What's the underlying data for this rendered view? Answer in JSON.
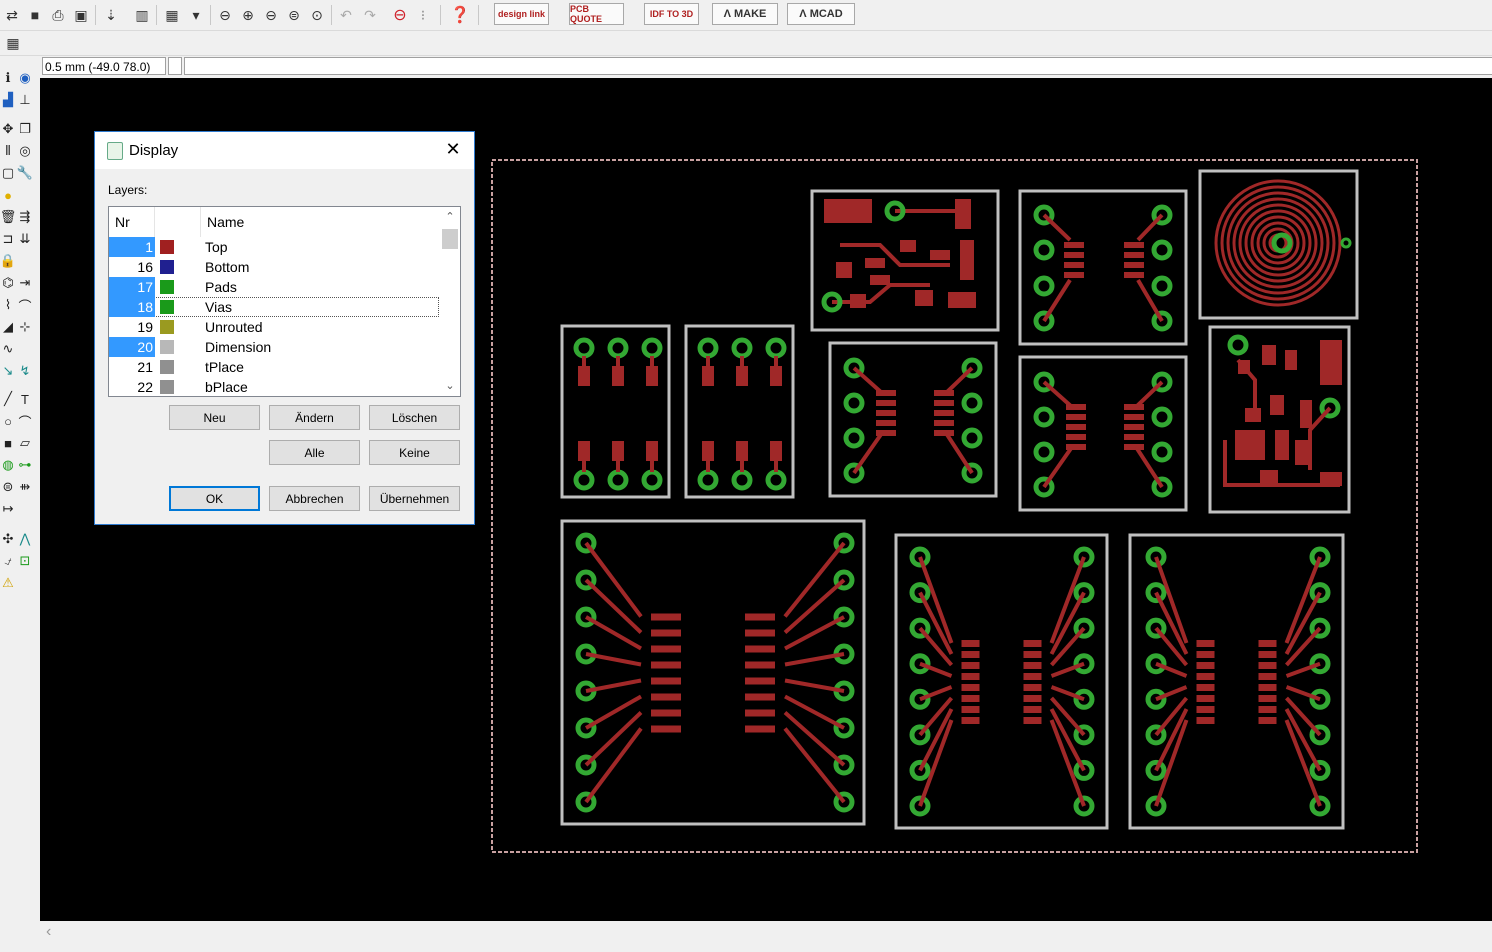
{
  "toolbar": {
    "designlink_label": "design link",
    "pcbquote_label": "PCB QUOTE",
    "idf_label": "IDF TO 3D",
    "make_label": "MAKE",
    "mcad_label": "MCAD"
  },
  "coordinate": "0.5 mm (-49.0 78.0)",
  "dialog": {
    "title": "Display",
    "layers_label": "Layers:",
    "col_nr": "Nr",
    "col_name": "Name",
    "layers": [
      {
        "nr": "1",
        "name": "Top",
        "color": "#a02020",
        "selected": true
      },
      {
        "nr": "16",
        "name": "Bottom",
        "color": "#202090",
        "selected": false
      },
      {
        "nr": "17",
        "name": "Pads",
        "color": "#1a9a1a",
        "selected": true
      },
      {
        "nr": "18",
        "name": "Vias",
        "color": "#1a9a1a",
        "selected": true
      },
      {
        "nr": "19",
        "name": "Unrouted",
        "color": "#9a9a20",
        "selected": false
      },
      {
        "nr": "20",
        "name": "Dimension",
        "color": "#b8b8b8",
        "selected": true
      },
      {
        "nr": "21",
        "name": "tPlace",
        "color": "#909090",
        "selected": false
      },
      {
        "nr": "22",
        "name": "bPlace",
        "color": "#909090",
        "selected": false
      }
    ],
    "btn_new": "Neu",
    "btn_change": "Ändern",
    "btn_delete": "Löschen",
    "btn_all": "Alle",
    "btn_none": "Keine",
    "btn_ok": "OK",
    "btn_cancel": "Abbrechen",
    "btn_apply": "Übernehmen"
  },
  "colors": {
    "canvas": "#000000",
    "trace": "#a02828",
    "pad": "#33a833",
    "outline": "#c0c0c0",
    "selection": "#3399ff"
  }
}
